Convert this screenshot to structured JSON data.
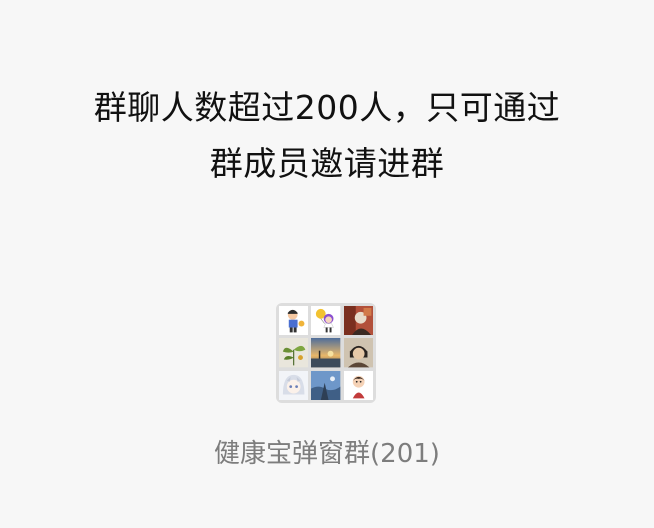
{
  "notice": {
    "line1": "群聊人数超过200人，只可通过",
    "line2": "群成员邀请进群"
  },
  "group": {
    "name": "健康宝弹窗群(201)",
    "avatar_icons": [
      "cartoon-boy-avatar-icon",
      "cartoon-girl-balloon-avatar-icon",
      "painting-avatar-icon",
      "plant-avatar-icon",
      "sunset-avatar-icon",
      "portrait-avatar-icon",
      "anime-girl-avatar-icon",
      "blue-sky-avatar-icon",
      "cartoon-child-avatar-icon"
    ]
  },
  "colors": {
    "background": "#f7f7f7",
    "title_text": "#111111",
    "group_name_text": "#7d7d7d",
    "avatar_grid_bg": "#dddddd"
  }
}
